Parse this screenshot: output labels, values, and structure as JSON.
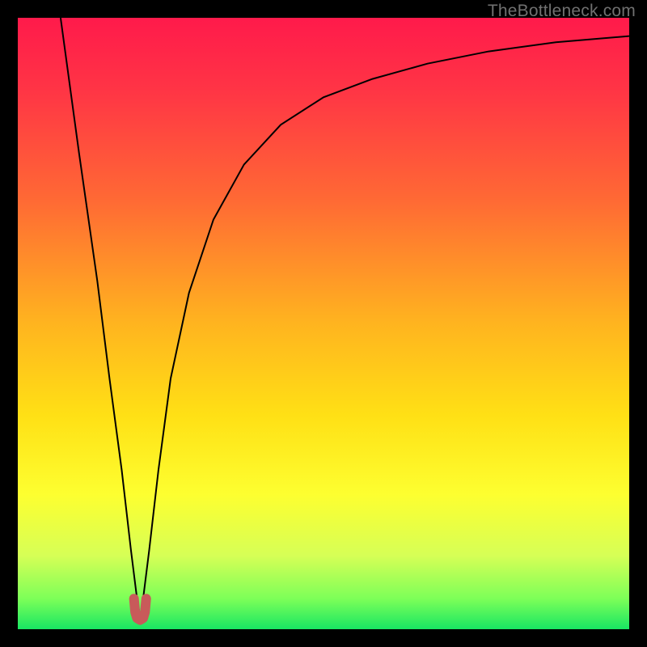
{
  "watermark": "TheBottleneck.com",
  "chart_data": {
    "type": "line",
    "title": "",
    "xlabel": "",
    "ylabel": "",
    "xlim": [
      0,
      100
    ],
    "ylim": [
      0,
      100
    ],
    "background_gradient": {
      "stops": [
        {
          "pct": 0,
          "color": "#ff1a4b"
        },
        {
          "pct": 12,
          "color": "#ff3545"
        },
        {
          "pct": 30,
          "color": "#ff6a34"
        },
        {
          "pct": 50,
          "color": "#ffb41f"
        },
        {
          "pct": 65,
          "color": "#ffe015"
        },
        {
          "pct": 78,
          "color": "#fdff30"
        },
        {
          "pct": 88,
          "color": "#d6ff56"
        },
        {
          "pct": 95,
          "color": "#7dff58"
        },
        {
          "pct": 100,
          "color": "#18e663"
        }
      ]
    },
    "series": [
      {
        "name": "bottleneck-curve",
        "color": "#000000",
        "stroke_width": 2,
        "x": [
          7,
          10,
          13,
          15,
          17,
          18.5,
          19.5,
          20,
          20.5,
          21.5,
          23,
          25,
          28,
          32,
          37,
          43,
          50,
          58,
          67,
          77,
          88,
          100
        ],
        "values": [
          100,
          78,
          57,
          41,
          26,
          13,
          5,
          2,
          5,
          13,
          26,
          41,
          55,
          67,
          76,
          82.5,
          87,
          90,
          92.5,
          94.5,
          96,
          97
        ]
      }
    ],
    "markers": [
      {
        "name": "curve-minimum",
        "shape": "u",
        "color": "#c85a5a",
        "stroke_width": 12,
        "x": [
          19,
          19.2,
          19.5,
          20,
          20.5,
          20.8,
          21
        ],
        "y": [
          5.0,
          2.8,
          1.8,
          1.5,
          1.8,
          2.8,
          5.0
        ]
      }
    ]
  }
}
